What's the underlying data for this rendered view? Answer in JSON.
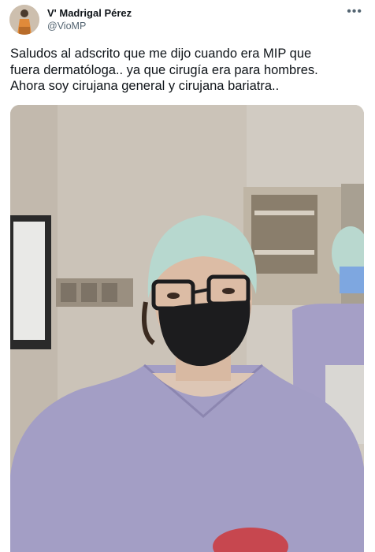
{
  "author": {
    "display_name": "V' Madrigal Pérez",
    "handle": "@VioMP"
  },
  "tweet": {
    "text": "Saludos al adscrito que me dijo cuando era MIP que\nfuera dermatóloga.. ya que cirugía era para hombres.\nAhora soy cirujana general y cirujana bariatra.."
  },
  "icons": {
    "more": "more-horizontal-icon"
  },
  "colors": {
    "text": "#0f1419",
    "secondary": "#536471",
    "scrubs": "#a49fc6",
    "cap": "#b7d8cf",
    "mask": "#1c1c1e"
  }
}
